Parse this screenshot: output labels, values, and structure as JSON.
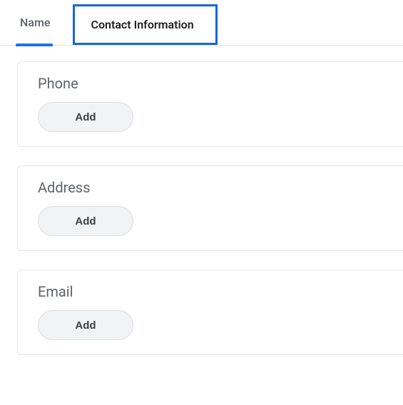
{
  "colors": {
    "accent": "#1a73e8",
    "focus_ring": "#1967d2",
    "text_muted": "#5f6368",
    "border": "#e3e5e8",
    "button_bg": "#f1f3f4"
  },
  "tabs": [
    {
      "id": "name",
      "label": "Name",
      "selected": false,
      "underlined": true
    },
    {
      "id": "contact",
      "label": "Contact Information",
      "selected": true,
      "underlined": false
    }
  ],
  "sections": [
    {
      "id": "phone",
      "title": "Phone",
      "button_label": "Add"
    },
    {
      "id": "address",
      "title": "Address",
      "button_label": "Add"
    },
    {
      "id": "email",
      "title": "Email",
      "button_label": "Add"
    }
  ]
}
